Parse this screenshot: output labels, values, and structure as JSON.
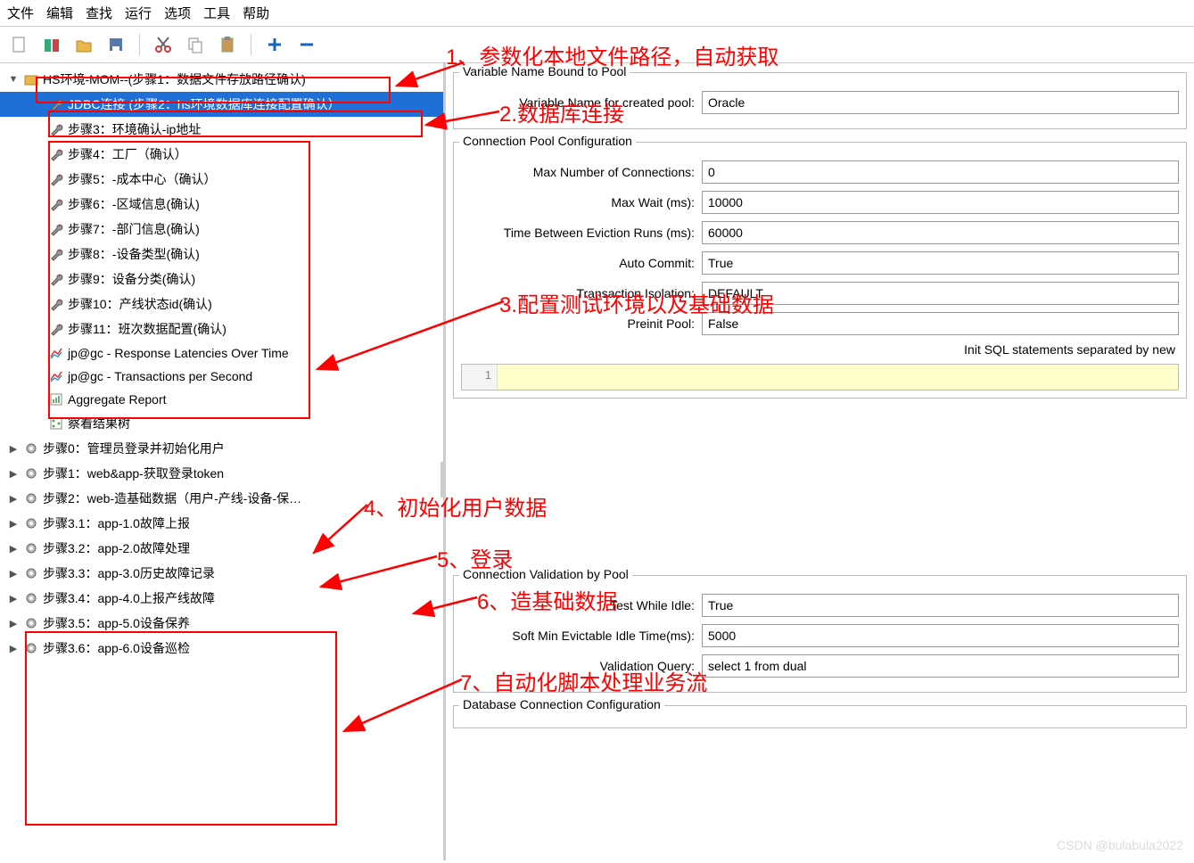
{
  "menu": [
    "文件",
    "编辑",
    "查找",
    "运行",
    "选项",
    "工具",
    "帮助"
  ],
  "tree": {
    "items": [
      {
        "indent": 0,
        "arrow": "▼",
        "icon": "folder",
        "label": "HS环境-MOM--(步骤1：数据文件存放路径确认)",
        "sel": false
      },
      {
        "indent": 1,
        "arrow": "",
        "icon": "wrench",
        "label": "JDBC连接 (步骤2：hs环境数据库连接配置确认）",
        "sel": true
      },
      {
        "indent": 1,
        "arrow": "",
        "icon": "wrench",
        "label": "步骤3：环境确认-ip地址",
        "sel": false
      },
      {
        "indent": 1,
        "arrow": "",
        "icon": "wrench",
        "label": "步骤4：工厂（确认）",
        "sel": false
      },
      {
        "indent": 1,
        "arrow": "",
        "icon": "wrench",
        "label": "步骤5：-成本中心（确认）",
        "sel": false
      },
      {
        "indent": 1,
        "arrow": "",
        "icon": "wrench",
        "label": "步骤6：-区域信息(确认)",
        "sel": false
      },
      {
        "indent": 1,
        "arrow": "",
        "icon": "wrench",
        "label": "步骤7：-部门信息(确认)",
        "sel": false
      },
      {
        "indent": 1,
        "arrow": "",
        "icon": "wrench",
        "label": "步骤8：-设备类型(确认)",
        "sel": false
      },
      {
        "indent": 1,
        "arrow": "",
        "icon": "wrench",
        "label": "步骤9：设备分类(确认)",
        "sel": false
      },
      {
        "indent": 1,
        "arrow": "",
        "icon": "wrench",
        "label": "步骤10：产线状态id(确认)",
        "sel": false
      },
      {
        "indent": 1,
        "arrow": "",
        "icon": "wrench",
        "label": "步骤11：班次数据配置(确认)",
        "sel": false
      },
      {
        "indent": 1,
        "arrow": "",
        "icon": "chart",
        "label": "jp@gc - Response Latencies Over Time",
        "sel": false
      },
      {
        "indent": 1,
        "arrow": "",
        "icon": "chart",
        "label": "jp@gc - Transactions per Second",
        "sel": false
      },
      {
        "indent": 1,
        "arrow": "",
        "icon": "report",
        "label": "Aggregate Report",
        "sel": false
      },
      {
        "indent": 1,
        "arrow": "",
        "icon": "tree",
        "label": "察看结果树",
        "sel": false
      },
      {
        "indent": 0,
        "arrow": "▶",
        "icon": "gear",
        "label": "步骤0：管理员登录并初始化用户",
        "sel": false
      },
      {
        "indent": 0,
        "arrow": "▶",
        "icon": "gear",
        "label": "步骤1：web&app-获取登录token",
        "sel": false
      },
      {
        "indent": 0,
        "arrow": "▶",
        "icon": "gear",
        "label": "步骤2：web-造基础数据（用户-产线-设备-保…",
        "sel": false
      },
      {
        "indent": 0,
        "arrow": "▶",
        "icon": "gear",
        "label": "步骤3.1：app-1.0故障上报",
        "sel": false
      },
      {
        "indent": 0,
        "arrow": "▶",
        "icon": "gear",
        "label": "步骤3.2：app-2.0故障处理",
        "sel": false
      },
      {
        "indent": 0,
        "arrow": "▶",
        "icon": "gear",
        "label": "步骤3.3：app-3.0历史故障记录",
        "sel": false
      },
      {
        "indent": 0,
        "arrow": "▶",
        "icon": "gear",
        "label": "步骤3.4：app-4.0上报产线故障",
        "sel": false
      },
      {
        "indent": 0,
        "arrow": "▶",
        "icon": "gear",
        "label": "步骤3.5：app-5.0设备保养",
        "sel": false
      },
      {
        "indent": 0,
        "arrow": "▶",
        "icon": "gear",
        "label": "步骤3.6：app-6.0设备巡检",
        "sel": false
      }
    ]
  },
  "form": {
    "section1_title": "Variable Name Bound to Pool",
    "varname_label": "Variable Name for created pool:",
    "varname_value": "Oracle",
    "section2_title": "Connection Pool Configuration",
    "maxconn_label": "Max Number of Connections:",
    "maxconn_value": "0",
    "maxwait_label": "Max Wait (ms):",
    "maxwait_value": "10000",
    "evict_label": "Time Between Eviction Runs (ms):",
    "evict_value": "60000",
    "autocommit_label": "Auto Commit:",
    "autocommit_value": "True",
    "isolation_label": "Transaction Isolation:",
    "isolation_value": "DEFAULT",
    "preinit_label": "Preinit Pool:",
    "preinit_value": "False",
    "initsql_label": "Init SQL statements separated by new",
    "gutter_num": "1",
    "section3_title": "Connection Validation by Pool",
    "testidle_label": "Test While Idle:",
    "testidle_value": "True",
    "softmin_label": "Soft Min Evictable Idle Time(ms):",
    "softmin_value": "5000",
    "valquery_label": "Validation Query:",
    "valquery_value": "select 1 from dual",
    "section4_title": "Database Connection Configuration"
  },
  "annotations": {
    "a1": "1、参数化本地文件路径，自动获取",
    "a2": "2.数据库连接",
    "a3": "3.配置测试环境以及基础数据",
    "a4": "4、初始化用户数据",
    "a5": "5、登录",
    "a6": "6、造基础数据",
    "a7": "7、自动化脚本处理业务流"
  },
  "watermark": "CSDN @bulabula2022"
}
